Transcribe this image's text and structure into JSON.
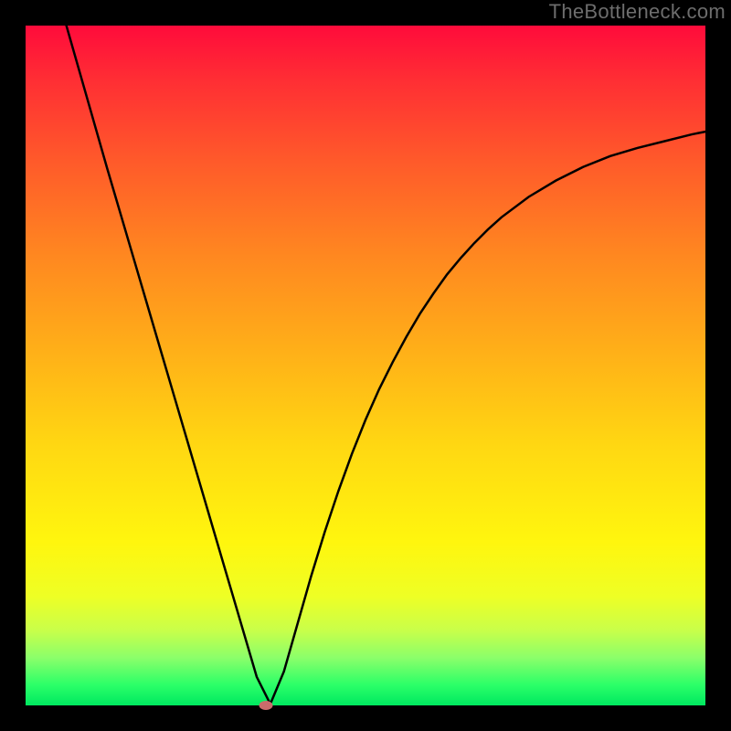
{
  "watermark": "TheBottleneck.com",
  "chart_data": {
    "type": "line",
    "title": "",
    "xlabel": "",
    "ylabel": "",
    "xlim": [
      0,
      100
    ],
    "ylim": [
      0,
      100
    ],
    "grid": false,
    "legend": false,
    "series": [
      {
        "name": "curve",
        "x": [
          6,
          8,
          10,
          12,
          14,
          16,
          18,
          20,
          22,
          24,
          26,
          28,
          30,
          32,
          34,
          36,
          38,
          40,
          42,
          44,
          46,
          48,
          50,
          52,
          54,
          56,
          58,
          60,
          62,
          64,
          66,
          68,
          70,
          74,
          78,
          82,
          86,
          90,
          94,
          98,
          100
        ],
        "y": [
          100,
          93,
          86,
          79,
          72.2,
          65.4,
          58.6,
          51.8,
          45,
          38.2,
          31.4,
          24.6,
          17.8,
          11,
          4.2,
          0.2,
          5,
          12,
          19,
          25.5,
          31.5,
          37,
          42,
          46.5,
          50.5,
          54.2,
          57.6,
          60.6,
          63.4,
          65.8,
          68,
          70,
          71.8,
          74.8,
          77.2,
          79.2,
          80.8,
          82,
          83,
          84,
          84.4
        ]
      }
    ],
    "minimum_point": {
      "x": 35.3,
      "y": 0.0
    },
    "min_marker_color": "#c96b6b",
    "curve_stroke": "#000000",
    "curve_stroke_width": 2.5,
    "background_gradient_stops": [
      {
        "pos": 0.0,
        "color": "#ff0b3b"
      },
      {
        "pos": 0.08,
        "color": "#ff2e34"
      },
      {
        "pos": 0.2,
        "color": "#ff5a2a"
      },
      {
        "pos": 0.34,
        "color": "#ff8820"
      },
      {
        "pos": 0.48,
        "color": "#ffb018"
      },
      {
        "pos": 0.62,
        "color": "#ffd812"
      },
      {
        "pos": 0.76,
        "color": "#fff60e"
      },
      {
        "pos": 0.84,
        "color": "#eeff25"
      },
      {
        "pos": 0.89,
        "color": "#c8ff4a"
      },
      {
        "pos": 0.93,
        "color": "#8bff6a"
      },
      {
        "pos": 0.97,
        "color": "#2bff68"
      },
      {
        "pos": 1.0,
        "color": "#00e860"
      }
    ]
  }
}
